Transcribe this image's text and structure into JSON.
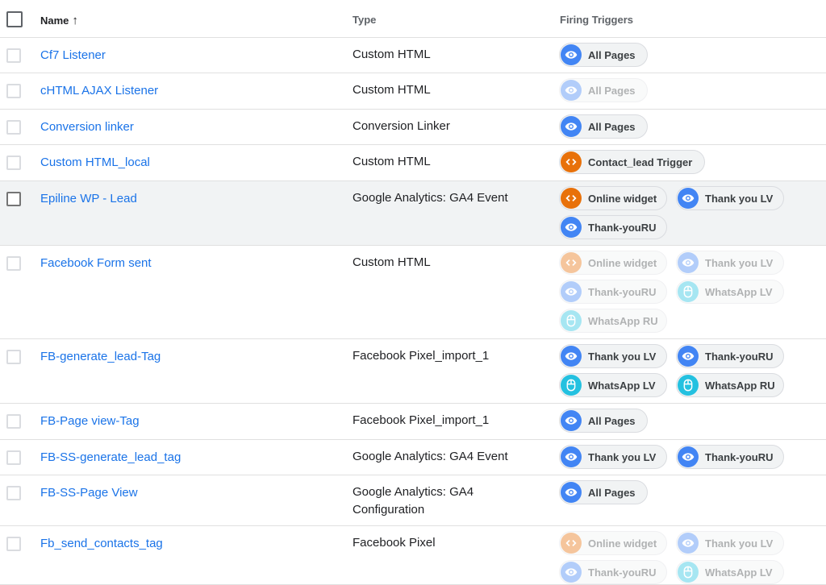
{
  "header": {
    "name": "Name",
    "sort_arrow": "↑",
    "type": "Type",
    "triggers": "Firing Triggers"
  },
  "colors": {
    "link": "#1a73e8",
    "page_view": "#4285f4",
    "custom_event": "#e8710a",
    "click": "#24c1e0"
  },
  "rows": [
    {
      "name": "Cf7 Listener",
      "type": "Custom HTML",
      "triggers": [
        {
          "label": "All Pages",
          "icon": "eye-icon",
          "enabled": true
        }
      ]
    },
    {
      "name": "cHTML AJAX Listener",
      "type": "Custom HTML",
      "triggers": [
        {
          "label": "All Pages",
          "icon": "eye-icon",
          "enabled": false
        }
      ]
    },
    {
      "name": "Conversion linker",
      "type": "Conversion Linker",
      "triggers": [
        {
          "label": "All Pages",
          "icon": "eye-icon",
          "enabled": true
        }
      ]
    },
    {
      "name": "Custom HTML_local",
      "type": "Custom HTML",
      "triggers": [
        {
          "label": "Contact_lead Trigger",
          "icon": "code-icon",
          "enabled": true
        }
      ]
    },
    {
      "name": "Epiline WP - Lead",
      "type": "Google Analytics: GA4 Event",
      "triggers": [
        {
          "label": "Online widget",
          "icon": "code-icon",
          "enabled": true
        },
        {
          "label": "Thank you LV",
          "icon": "eye-icon",
          "enabled": true
        },
        {
          "label": "Thank-youRU",
          "icon": "eye-icon",
          "enabled": true
        }
      ]
    },
    {
      "name": "Facebook Form sent",
      "type": "Custom HTML",
      "triggers": [
        {
          "label": "Online widget",
          "icon": "code-icon",
          "enabled": false
        },
        {
          "label": "Thank you LV",
          "icon": "eye-icon",
          "enabled": false
        },
        {
          "label": "Thank-youRU",
          "icon": "eye-icon",
          "enabled": false
        },
        {
          "label": "WhatsApp LV",
          "icon": "mouse-icon",
          "enabled": false
        },
        {
          "label": "WhatsApp RU",
          "icon": "mouse-icon",
          "enabled": false
        }
      ]
    },
    {
      "name": "FB-generate_lead-Tag",
      "type": "Facebook Pixel_import_1",
      "triggers": [
        {
          "label": "Thank you LV",
          "icon": "eye-icon",
          "enabled": true
        },
        {
          "label": "Thank-youRU",
          "icon": "eye-icon",
          "enabled": true
        },
        {
          "label": "WhatsApp LV",
          "icon": "mouse-icon",
          "enabled": true
        },
        {
          "label": "WhatsApp RU",
          "icon": "mouse-icon",
          "enabled": true
        }
      ]
    },
    {
      "name": "FB-Page view-Tag",
      "type": "Facebook Pixel_import_1",
      "triggers": [
        {
          "label": "All Pages",
          "icon": "eye-icon",
          "enabled": true
        }
      ]
    },
    {
      "name": "FB-SS-generate_lead_tag",
      "type": "Google Analytics: GA4 Event",
      "triggers": [
        {
          "label": "Thank you LV",
          "icon": "eye-icon",
          "enabled": true
        },
        {
          "label": "Thank-youRU",
          "icon": "eye-icon",
          "enabled": true
        }
      ]
    },
    {
      "name": "FB-SS-Page View",
      "type": "Google Analytics: GA4 Configuration",
      "triggers": [
        {
          "label": "All Pages",
          "icon": "eye-icon",
          "enabled": true
        }
      ]
    },
    {
      "name": "Fb_send_contacts_tag",
      "type": "Facebook Pixel",
      "triggers": [
        {
          "label": "Online widget",
          "icon": "code-icon",
          "enabled": false
        },
        {
          "label": "Thank you LV",
          "icon": "eye-icon",
          "enabled": false
        },
        {
          "label": "Thank-youRU",
          "icon": "eye-icon",
          "enabled": false
        },
        {
          "label": "WhatsApp LV",
          "icon": "mouse-icon",
          "enabled": false
        }
      ]
    }
  ]
}
